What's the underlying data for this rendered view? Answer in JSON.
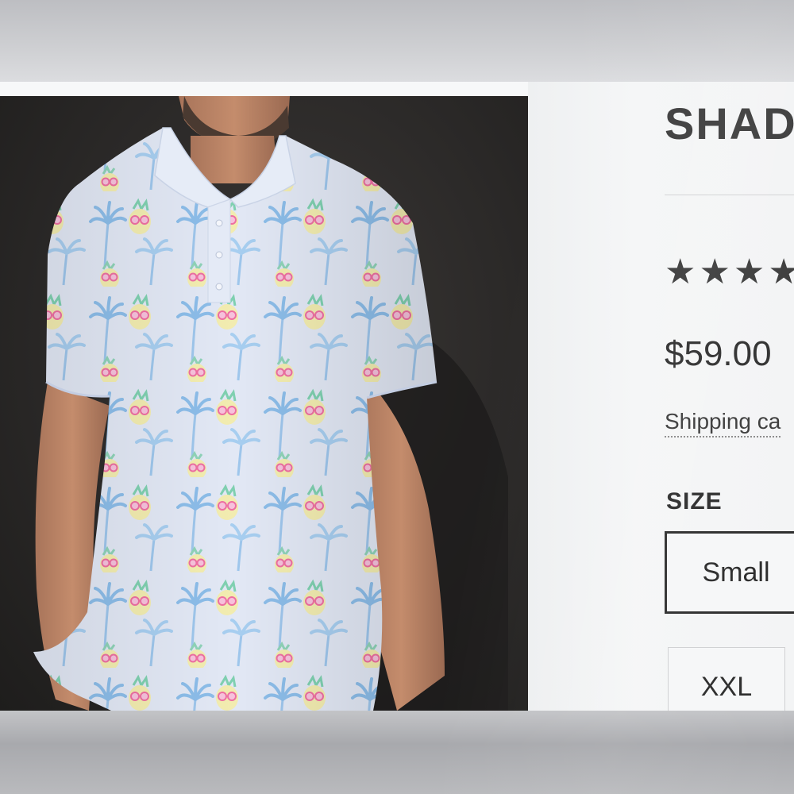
{
  "product": {
    "title": "SHAD",
    "rating_stars": "★★★★",
    "rating_value": 4,
    "price": "$59.00",
    "shipping_link": "Shipping ca"
  },
  "size_selector": {
    "label": "SIZE",
    "options": [
      {
        "label": "Small",
        "selected": true
      },
      {
        "label": "XXL",
        "selected": false
      }
    ]
  },
  "photo": {
    "subject": "model-wearing-polo-shirt",
    "pattern": "palm-trees-pineapples-with-pink-sunglasses"
  },
  "colors": {
    "photo_background": "#2b2928",
    "shirt_base": "#dfe6f4",
    "palm_blue": "#9ec6ec",
    "palm_green": "#8fd3b8",
    "pineapple_yellow": "#f3edb0",
    "sunglasses_pink": "#f07aa8",
    "text_dark": "#3c3c3c"
  }
}
